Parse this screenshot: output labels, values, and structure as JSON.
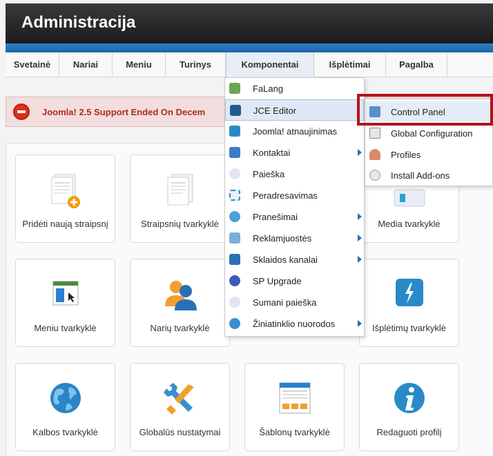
{
  "header": {
    "title": "Administracija"
  },
  "menubar": {
    "items": [
      "Svetainė",
      "Nariai",
      "Meniu",
      "Turinys",
      "Komponentai",
      "Išplėtimai",
      "Pagalba"
    ]
  },
  "alert": {
    "text": "Joomla! 2.5 Support Ended On Decem"
  },
  "tiles": [
    "Pridėti naują straipsnį",
    "Straipsnių tvarkyklė",
    "Media tvarkyklė",
    "Meniu tvarkyklė",
    "Narių tvarkyklė",
    "Išplėtimų tvarkyklė",
    "Kalbos tvarkyklė",
    "Globalūs nustatymai",
    "Šablonų tvarkyklė",
    "Redaguoti profilį"
  ],
  "dropdown": {
    "items": [
      {
        "label": "FaLang",
        "icon": "falang-icon"
      },
      {
        "label": "JCE Editor",
        "icon": "jce-editor-icon"
      },
      {
        "label": "Joomla! atnaujinimas",
        "icon": "joomla-update-icon"
      },
      {
        "label": "Kontaktai",
        "icon": "contacts-icon"
      },
      {
        "label": "Paieška",
        "icon": "search-icon"
      },
      {
        "label": "Peradresavimas",
        "icon": "redirect-icon"
      },
      {
        "label": "Pranešimai",
        "icon": "messages-icon"
      },
      {
        "label": "Reklamjuostės",
        "icon": "banners-icon"
      },
      {
        "label": "Sklaidos kanalai",
        "icon": "feeds-icon"
      },
      {
        "label": "SP Upgrade",
        "icon": "sp-upgrade-icon"
      },
      {
        "label": "Sumani paieška",
        "icon": "smart-search-icon"
      },
      {
        "label": "Žiniatinklio nuorodos",
        "icon": "weblinks-icon"
      }
    ]
  },
  "submenu": {
    "items": [
      {
        "label": "Control Panel",
        "icon": "control-panel-icon"
      },
      {
        "label": "Global Configuration",
        "icon": "global-config-icon"
      },
      {
        "label": "Profiles",
        "icon": "profiles-icon"
      },
      {
        "label": "Install Add-ons",
        "icon": "install-addons-icon"
      }
    ]
  }
}
